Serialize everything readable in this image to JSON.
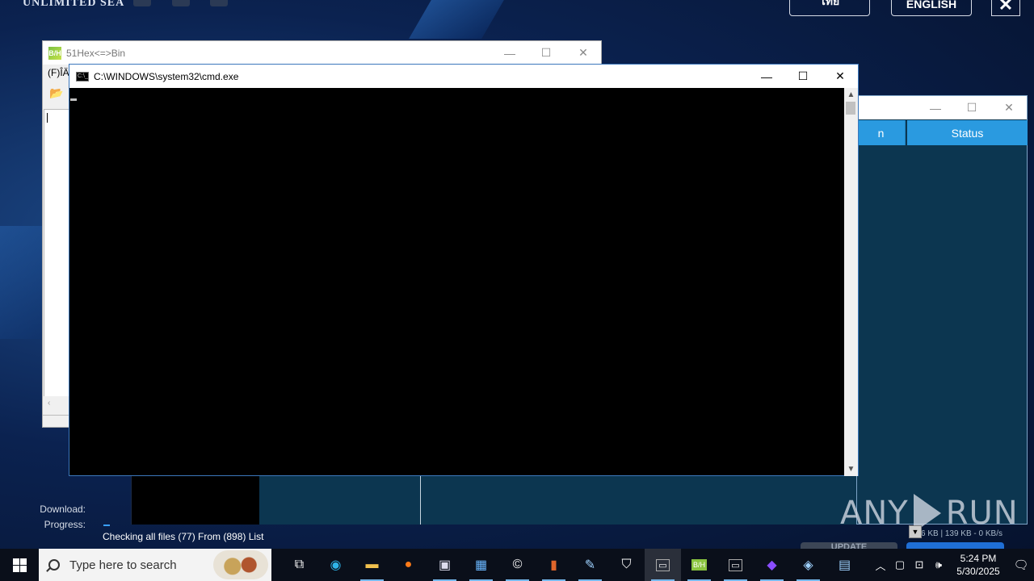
{
  "launcher": {
    "logo": "UNLIMITED SEA",
    "lang_thai": "ไทย",
    "lang_english": "ENGLISH",
    "close_glyph": "✕",
    "download_label": "Download:",
    "progress_label": "Progress:",
    "checking_text": "Checking all files (77) From (898) List",
    "speed_text": "6 KB | 139 KB - 0 KB/s",
    "update_label": "UPDATE",
    "status_header_partial": "n",
    "status_header": "Status"
  },
  "watermark": {
    "left": "ANY",
    "right": "RUN"
  },
  "win_hex": {
    "title": "51Hex<=>Bin",
    "icon_text": "B/H",
    "menu": "(F)ÎÄ"
  },
  "win_cmd": {
    "title": "C:\\WINDOWS\\system32\\cmd.exe",
    "icon_text": "C:\\_"
  },
  "window_buttons": {
    "minimize": "—",
    "maximize": "☐",
    "close": "✕"
  },
  "taskbar": {
    "search_placeholder": "Type here to search",
    "time": "5:24 PM",
    "date": "5/30/2025"
  }
}
